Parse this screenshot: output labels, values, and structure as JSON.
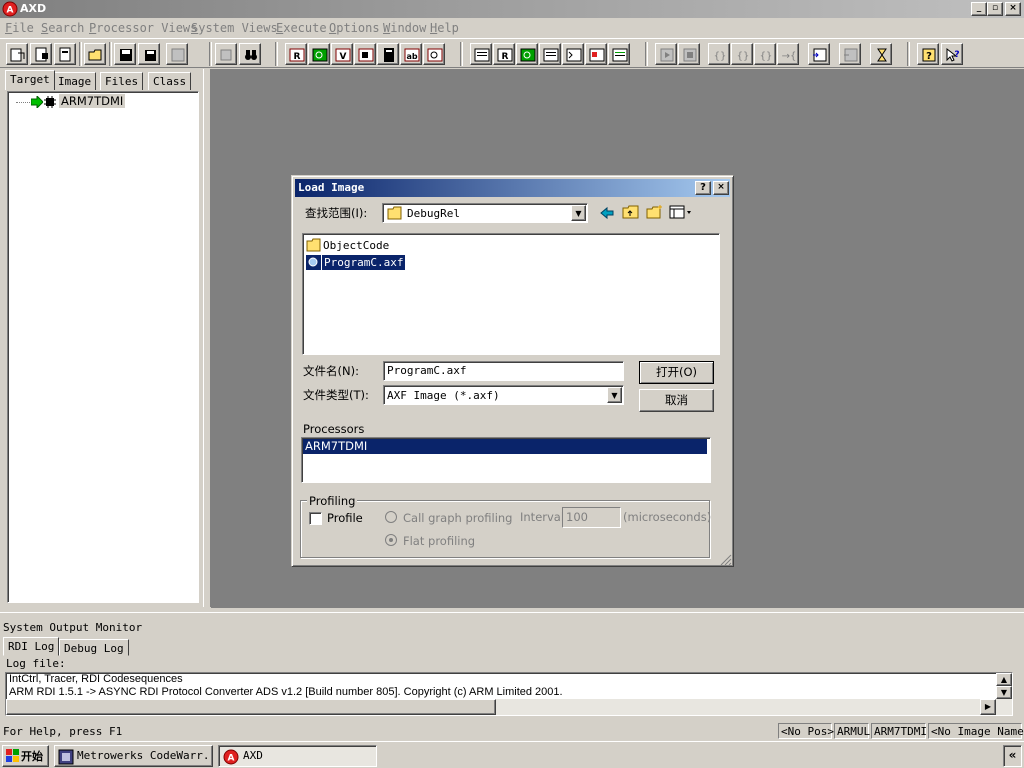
{
  "window": {
    "title": "AXD"
  },
  "menu": {
    "items": [
      {
        "label": "File",
        "u": "F",
        "rest": "ile"
      },
      {
        "label": "Search",
        "u": "S",
        "rest": "earch"
      },
      {
        "label": "Processor Views",
        "u": "P",
        "rest": "rocessor Views"
      },
      {
        "label": "System Views",
        "u": "S",
        "rest": "ystem Views"
      },
      {
        "label": "Execute",
        "u": "E",
        "rest": "xecute"
      },
      {
        "label": "Options",
        "u": "O",
        "rest": "ptions"
      },
      {
        "label": "Window",
        "u": "W",
        "rest": "indow"
      },
      {
        "label": "Help",
        "u": "H",
        "rest": "elp"
      }
    ]
  },
  "left_pane": {
    "tabs": [
      "Target",
      "Image",
      "Files",
      "Class"
    ],
    "tree_item": "ARM7TDMI"
  },
  "dialog": {
    "title": "Load Image",
    "look_in_label": "查找范围(I):",
    "look_in_value": "DebugRel",
    "files": [
      "ObjectCode",
      "ProgramC.axf"
    ],
    "filename_label": "文件名(N):",
    "filename_value": "ProgramC.axf",
    "filetype_label": "文件类型(T):",
    "filetype_value": "AXF Image (*.axf)",
    "open_label": "打开(O)",
    "cancel_label": "取消",
    "processors_label": "Processors",
    "processors": [
      "ARM7TDMI"
    ],
    "profiling": {
      "group_label": "Profiling",
      "profile_label": "Profile",
      "call_graph_label": "Call graph profiling",
      "flat_label": "Flat profiling",
      "interval_label": "Interval:",
      "interval_value": "100",
      "units_label": "(microseconds)"
    }
  },
  "output": {
    "title": "System Output Monitor",
    "tabs": [
      "RDI Log",
      "Debug Log"
    ],
    "log_file_label": "Log file:",
    "lines": [
      "IntCtrl, Tracer, RDI Codesequences",
      "ARM RDI 1.5.1 -> ASYNC RDI Protocol Converter ADS v1.2 [Build number 805]. Copyright (c) ARM Limited 2001."
    ]
  },
  "status": {
    "help": "For Help, press F1",
    "pos": "<No Pos>",
    "target": "ARMUL",
    "processor": "ARM7TDMI",
    "image": "<No Image Name>"
  },
  "taskbar": {
    "start": "开始",
    "tasks": [
      "Metrowerks CodeWarr...",
      "AXD"
    ],
    "tray": "«"
  },
  "colors": {
    "title_active": "#0a246a",
    "title_inactive": "#808080",
    "desktop": "#808080",
    "selection": "#0a246a"
  }
}
